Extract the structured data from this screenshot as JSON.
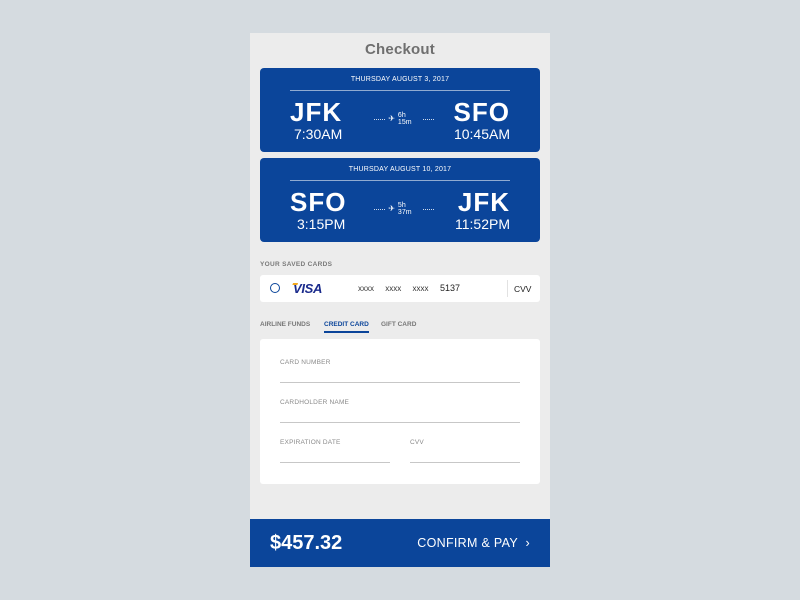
{
  "header": {
    "title": "Checkout"
  },
  "flights": [
    {
      "date": "THURSDAY AUGUST 3, 2017",
      "from_code": "JFK",
      "from_time": "7:30AM",
      "duration": "6h 15m",
      "to_code": "SFO",
      "to_time": "10:45AM"
    },
    {
      "date": "THURSDAY AUGUST 10, 2017",
      "from_code": "SFO",
      "from_time": "3:15PM",
      "duration": "5h 37m",
      "to_code": "JFK",
      "to_time": "11:52PM"
    }
  ],
  "saved_cards": {
    "label": "YOUR SAVED CARDS",
    "card": {
      "brand": "VISA",
      "masked": "xxxx xxxx xxxx",
      "last4": "5137",
      "cvv_label": "CVV",
      "selected": false
    }
  },
  "payment_tabs": [
    {
      "label": "AIRLINE FUNDS",
      "active": false
    },
    {
      "label": "CREDIT CARD",
      "active": true
    },
    {
      "label": "GIFT CARD",
      "active": false
    }
  ],
  "form": {
    "card_number_label": "CARD NUMBER",
    "cardholder_name_label": "CARDHOLDER NAME",
    "expiration_label": "EXPIRATION DATE",
    "cvv_label": "CVV"
  },
  "footer": {
    "amount": "$457.32",
    "confirm_label": "CONFIRM & PAY",
    "confirm_icon": "chevron-right-icon"
  },
  "colors": {
    "brand": "#0b459a",
    "background": "#ececec",
    "page": "#d5dbe0",
    "visa_gold": "#f2a81d"
  }
}
